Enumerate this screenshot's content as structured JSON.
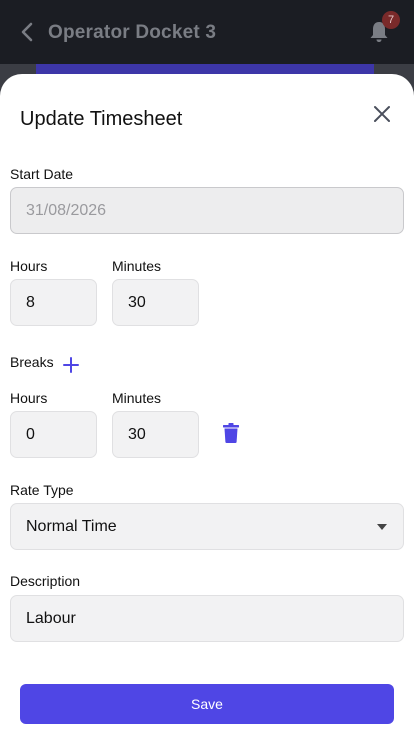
{
  "header": {
    "title": "Operator Docket 3",
    "notifications_count": "7"
  },
  "sheet": {
    "title": "Update Timesheet",
    "start_date": {
      "label": "Start Date",
      "value": "31/08/2026"
    },
    "work": {
      "hours_label": "Hours",
      "hours_value": "8",
      "minutes_label": "Minutes",
      "minutes_value": "30"
    },
    "breaks": {
      "label": "Breaks",
      "hours_label": "Hours",
      "hours_value": "0",
      "minutes_label": "Minutes",
      "minutes_value": "30"
    },
    "rate_type": {
      "label": "Rate Type",
      "value": "Normal Time"
    },
    "description": {
      "label": "Description",
      "value": "Labour"
    },
    "save_label": "Save"
  },
  "icons": {
    "back": "chevron-left-icon",
    "bell": "bell-icon",
    "close": "close-icon",
    "add": "plus-icon",
    "delete": "trash-icon",
    "dropdown": "caret-down-icon"
  },
  "colors": {
    "accent": "#4f46e5",
    "header_bg": "#1b1d23",
    "field_bg": "#f2f2f3",
    "badge": "#7a2a2a"
  }
}
